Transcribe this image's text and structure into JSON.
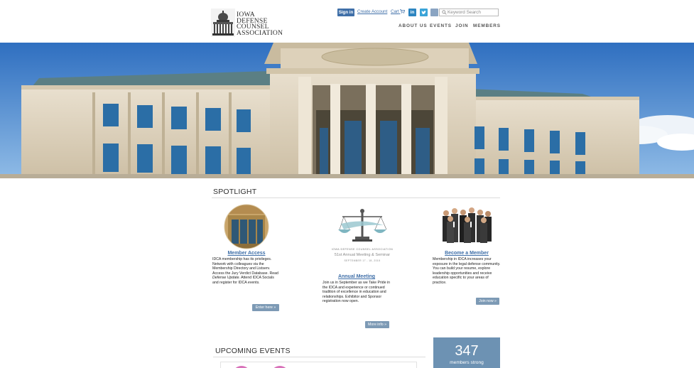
{
  "header": {
    "logo_lines": [
      "IOWA",
      "DEFENSE",
      "COUNSEL",
      "ASSOCIATION"
    ],
    "sign_in_label": "Sign in",
    "create_account_label": "Create Account",
    "cart_label": "Cart",
    "social": [
      {
        "name": "linkedin-icon",
        "glyph": "in"
      },
      {
        "name": "twitter-icon",
        "glyph": "t"
      },
      {
        "name": "facebook-icon",
        "glyph": ""
      }
    ],
    "search_placeholder": "Keyword Search",
    "nav": [
      "ABOUT US",
      "EVENTS",
      "JOIN",
      "MEMBERS"
    ]
  },
  "spotlight": {
    "title": "SPOTLIGHT",
    "member_access": {
      "heading": "Member Access",
      "body": "IDCA membership has its privileges. Network with colleagues via the Membership Directory and Listserv. Access the Jury Verdict Database. Read",
      "body_italic": "Defense Update.",
      "body_end": "Attend IDCA Socials and register for IDCA events.",
      "button": "Enter here »"
    },
    "annual_meeting": {
      "caption": "IOWA DEFENSE COUNSEL ASSOCIATION",
      "subtitle": "51st Annual Meeting & Seminar",
      "dates": "SEPTEMBER 17 - 18, 2015",
      "heading": "Annual Meeting",
      "body": "Join us in September as we Take Pride in the IDCA and experience or continued tradition of excellence in education and relationships. Exhibitor and Sponsor registration now open.",
      "button": "More info »"
    },
    "become_member": {
      "heading": "Become a Member",
      "body": "Membership in IDCA increases your exposure in the legal defense community. You can build your resume, explore leadership opportunities and receive education specific to your areas of practice.",
      "button": "Join now »"
    }
  },
  "upcoming": {
    "title": "UPCOMING EVENTS"
  },
  "stats": {
    "members_count": "347",
    "members_label": "members strong"
  },
  "colors": {
    "link_blue": "#3f6fa8",
    "button_blue": "#7d9ab5",
    "stat_box": "#6d92b3",
    "event_pink": "#d872b9"
  }
}
